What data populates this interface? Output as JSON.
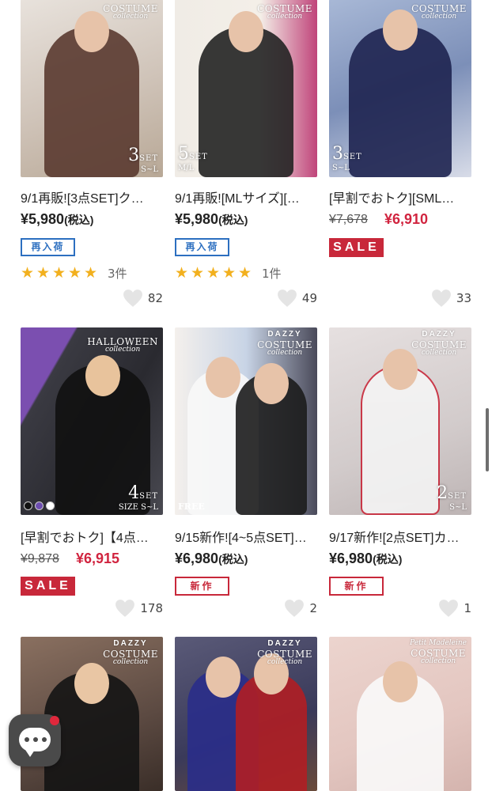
{
  "products": [
    {
      "title": "9/1再販![3点SET]ク…",
      "price": "¥5,980",
      "tax": "(税込)",
      "badge_type": "restock",
      "badge": "再入荷",
      "stars": 5,
      "review_count": "3件",
      "likes": "82",
      "brand_top": "COSTUME",
      "brand_bottom": "collection",
      "set_number": "3",
      "set_unit": "SET",
      "set_size": "S~L",
      "bg": "#d9cfc6"
    },
    {
      "title": "9/1再販![MLサイズ][…",
      "price": "¥5,980",
      "tax": "(税込)",
      "badge_type": "restock",
      "badge": "再入荷",
      "stars": 5,
      "review_count": "1件",
      "likes": "49",
      "brand_top": "COSTUME",
      "brand_bottom": "collection",
      "set_number": "5",
      "set_unit": "SET",
      "set_size": "M/L",
      "bg": "#c77a8b"
    },
    {
      "title": "[早割でおトク][SML…",
      "old_price": "¥7,678",
      "sale_price": "¥6,910",
      "badge_type": "sale",
      "badge": "SALE",
      "likes": "33",
      "brand_top": "COSTUME",
      "brand_bottom": "collection",
      "set_number": "3",
      "set_unit": "SET",
      "set_size": "S~L",
      "bg": "#6a7ea6"
    },
    {
      "title": "[早割でおトク]【4点…",
      "old_price": "¥9,878",
      "sale_price": "¥6,915",
      "badge_type": "sale",
      "badge": "SALE",
      "likes": "178",
      "brand_top": "HALLOWEEN",
      "brand_bottom": "collection",
      "set_number": "4",
      "set_unit": "SET",
      "set_size": "SIZE S~L",
      "bg": "#3a3a40"
    },
    {
      "title": "9/15新作![4~5点SET]…",
      "price": "¥6,980",
      "tax": "(税込)",
      "badge_type": "new",
      "badge": "新作",
      "likes": "2",
      "brand_logo": "DAZZY",
      "brand_top": "COSTUME",
      "brand_bottom": "collection",
      "free_tag": "FREE",
      "bg": "#a8b4c4"
    },
    {
      "title": "9/17新作![2点SET]カ…",
      "price": "¥6,980",
      "tax": "(税込)",
      "badge_type": "new",
      "badge": "新作",
      "likes": "1",
      "brand_logo": "DAZZY",
      "brand_top": "COSTUME",
      "brand_bottom": "collection",
      "set_number": "2",
      "set_unit": "SET",
      "set_size": "S~L",
      "bg": "#d8d2d2"
    },
    {
      "brand_logo": "DAZZY",
      "brand_top": "COSTUME",
      "brand_bottom": "collection",
      "bg": "#5c4a42"
    },
    {
      "brand_logo": "DAZZY",
      "brand_top": "COSTUME",
      "brand_bottom": "collection",
      "bg": "#3a3a5a"
    },
    {
      "brand_logo": "Petit Madeleine",
      "brand_top": "COSTUME",
      "brand_bottom": "collection",
      "bg": "#e3c6c0"
    }
  ],
  "colors": {
    "sale_red": "#d1243f",
    "restock_blue": "#2c6fc0",
    "star_gold": "#f2b01e",
    "chat_bg": "#4a4a4a"
  },
  "icons": {
    "like": "heart-icon",
    "star": "star-icon",
    "chat": "chat-bubble-icon"
  }
}
